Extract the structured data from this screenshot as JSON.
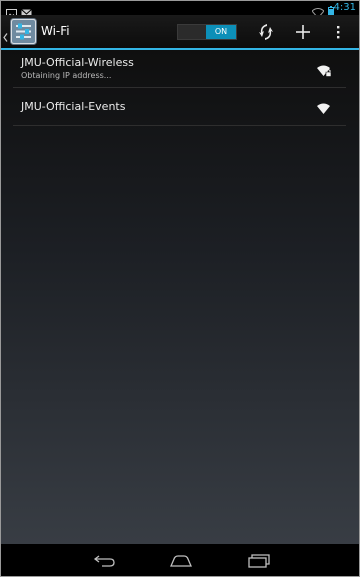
{
  "status_bar": {
    "time": "4:31",
    "accent": "#33b5e5",
    "icons": [
      "gallery-notification-icon",
      "email-notification-icon",
      "wifi-status-icon",
      "battery-icon"
    ]
  },
  "action_bar": {
    "title": "Wi-Fi",
    "toggle": {
      "state": "ON"
    },
    "actions": [
      "wps-icon",
      "add-network-icon",
      "overflow-menu-icon"
    ]
  },
  "networks": [
    {
      "name": "JMU-Official-Wireless",
      "status": "Obtaining IP address...",
      "signal": "wifi-lock-icon"
    },
    {
      "name": "JMU-Official-Events",
      "status": "",
      "signal": "wifi-signal-icon"
    }
  ],
  "nav_bar": {
    "buttons": [
      "back-icon",
      "home-icon",
      "recent-apps-icon"
    ]
  }
}
